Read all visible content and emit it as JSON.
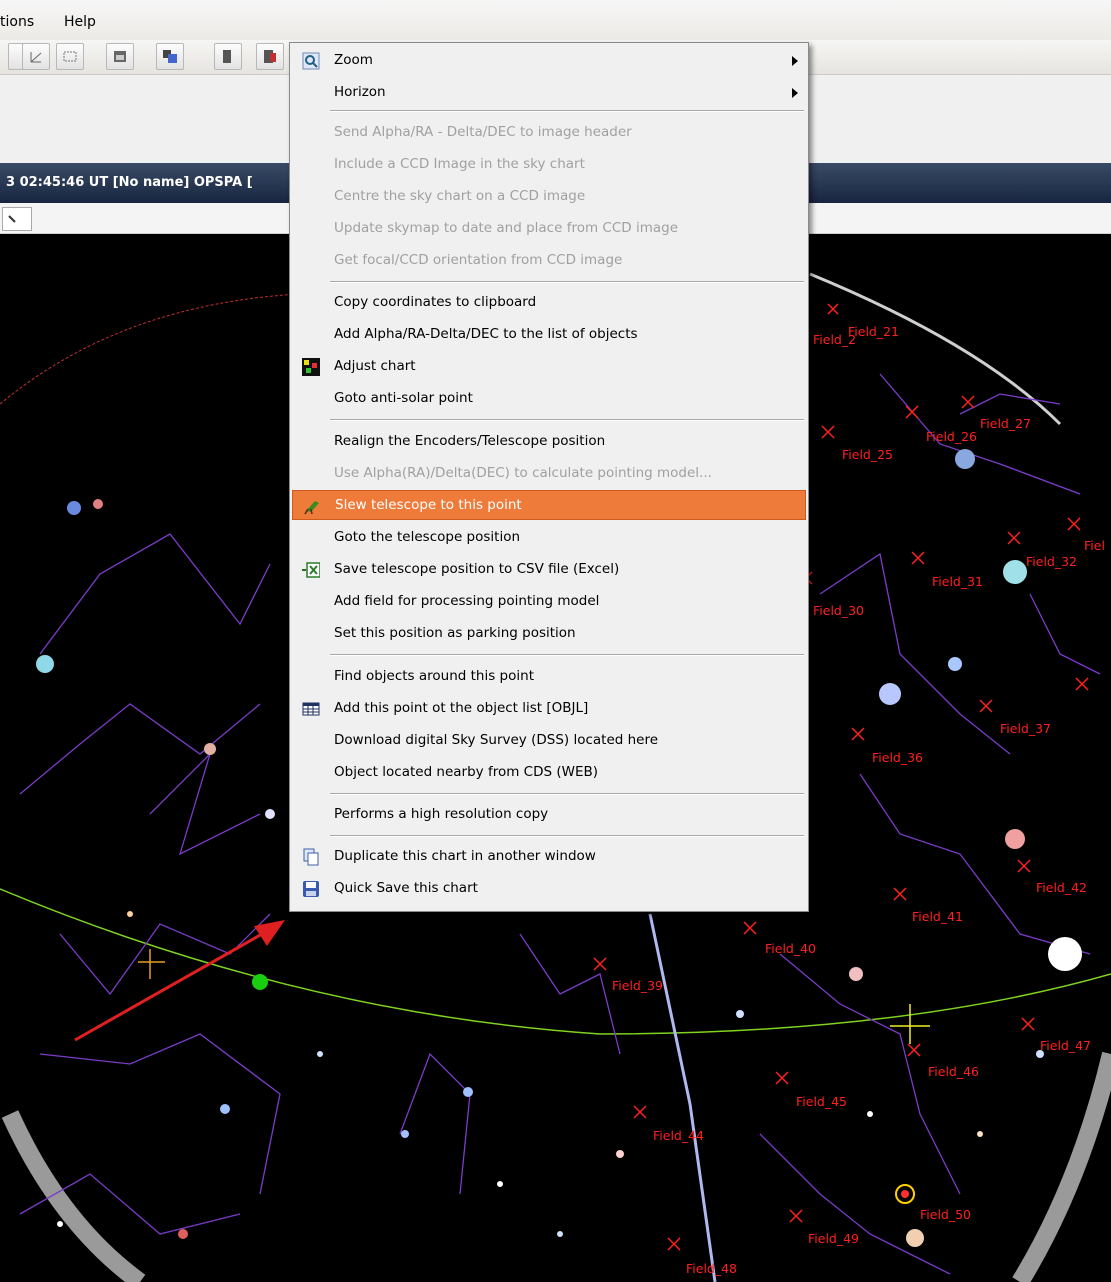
{
  "menubar": {
    "options_label": "tions",
    "help_label": "Help"
  },
  "title": "3 02:45:46 UT [No name]  OPSPA [",
  "context_menu": {
    "zoom": "Zoom",
    "horizon": "Horizon",
    "send_header": "Send Alpha/RA - Delta/DEC to image header",
    "include_ccd": "Include a CCD Image in the sky chart",
    "centre_ccd": "Centre the sky chart on a CCD image",
    "update_skymap": "Update skymap to date and place from CCD image",
    "get_focal": "Get focal/CCD orientation from CCD image",
    "copy_coords": "Copy coordinates to clipboard",
    "add_alpha": "Add Alpha/RA-Delta/DEC to the list of objects",
    "adjust_chart": "Adjust chart",
    "goto_antisolar": "Goto anti-solar point",
    "realign": "Realign the Encoders/Telescope position",
    "use_alpha": "Use Alpha(RA)/Delta(DEC) to calculate pointing model...",
    "slew": "Slew telescope to this point",
    "goto_telescope": "Goto the telescope position",
    "save_csv": "Save telescope position to CSV file (Excel)",
    "add_field": "Add field for processing pointing model",
    "set_parking": "Set this position as parking position",
    "find_objects": "Find objects around this point",
    "add_point_objl": "Add this point ot the object list [OBJL]",
    "download_dss": "Download digital Sky Survey (DSS) located here",
    "object_cds": "Object located nearby from CDS (WEB)",
    "high_res": "Performs a high resolution copy",
    "duplicate": "Duplicate this chart in another window",
    "quick_save": "Quick Save this chart"
  },
  "fields": {
    "f20": "Field_2",
    "f21": "Field_21",
    "f25": "Field_25",
    "f26": "Field_26",
    "f27": "Field_27",
    "f30": "Field_30",
    "f31": "Field_31",
    "f32": "Field_32",
    "fie": "Fiel",
    "f36": "Field_36",
    "f37": "Field_37",
    "f39": "Field_39",
    "f40": "Field_40",
    "f41": "Field_41",
    "f42": "Field_42",
    "f44": "Field_44",
    "f45": "Field_45",
    "f46": "Field_46",
    "f47": "Field_47",
    "f48": "Field_48",
    "f49": "Field_49",
    "f50": "Field_50"
  },
  "colors": {
    "highlight": "#ef7b3b",
    "field_label": "#ff2020",
    "constellation_line": "#7a3cc8",
    "horizon_line": "#7fd320",
    "arrow": "#e02020"
  }
}
